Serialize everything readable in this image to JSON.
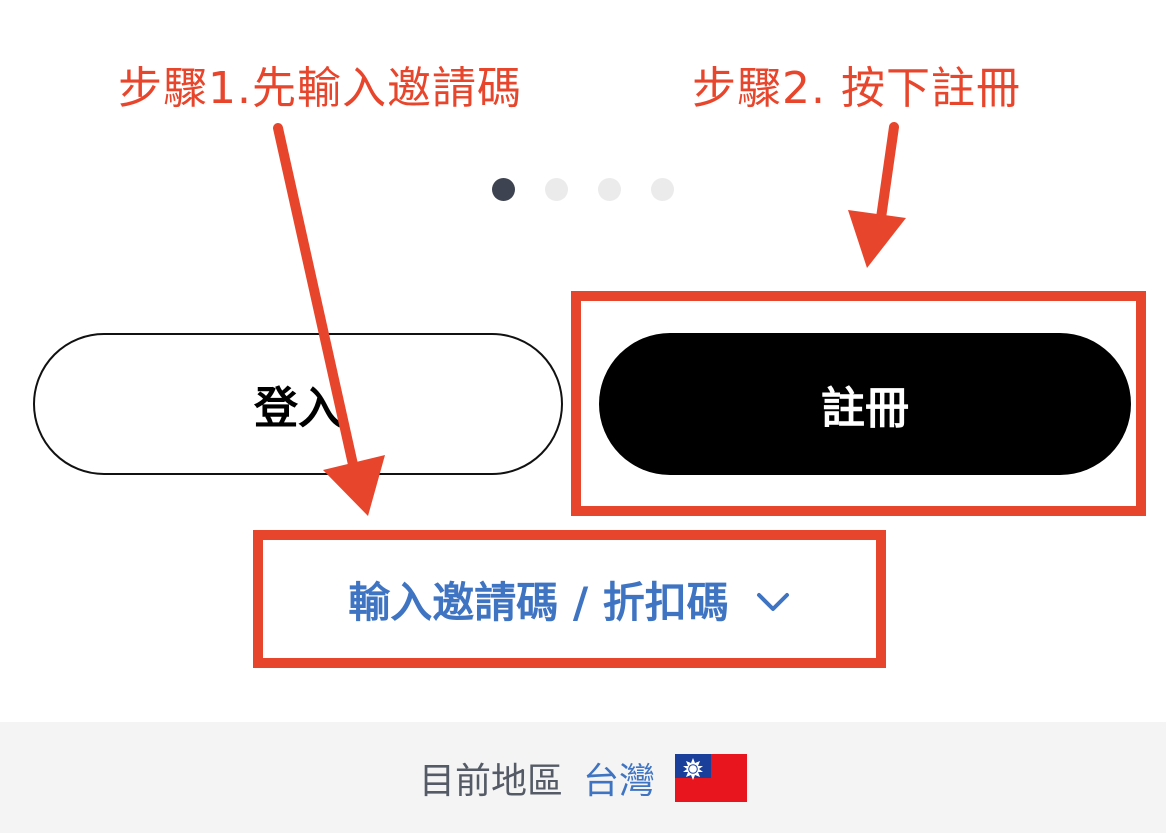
{
  "annotations": {
    "step1": "步驟1.先輸入邀請碼",
    "step2": "步驟2. 按下註冊"
  },
  "carousel": {
    "count": 4,
    "active_index": 0
  },
  "buttons": {
    "login_label": "登入",
    "register_label": "註冊"
  },
  "invite": {
    "label": "輸入邀請碼 / 折扣碼",
    "icon": "chevron-down-icon"
  },
  "footer": {
    "region_label": "目前地區",
    "region_value": "台灣",
    "flag_icon": "taiwan-flag-icon"
  },
  "colors": {
    "annotation": "#e8462c",
    "link": "#3f74c2",
    "dot_active": "#3d4351",
    "dot_inactive": "#ebebeb",
    "primary_button": "#000000"
  }
}
